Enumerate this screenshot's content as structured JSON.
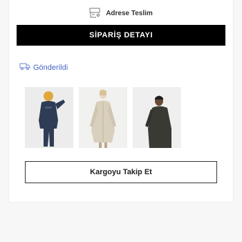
{
  "delivery": {
    "icon": "delivery-box-icon",
    "label": "Adrese Teslim"
  },
  "order": {
    "detail_button_label": "SİPARİŞ DETAYI",
    "status_icon": "truck-icon",
    "status_text": "Gönderildi",
    "status_color": "#4a66c8"
  },
  "products": [
    {
      "name": "product-image-navy-jacket-kid",
      "color": "#2e3d55"
    },
    {
      "name": "product-image-beige-coat",
      "color": "#d8cfbd"
    },
    {
      "name": "product-image-dark-jacket",
      "color": "#3a3a34"
    }
  ],
  "track_button_label": "Kargoyu Takip Et"
}
